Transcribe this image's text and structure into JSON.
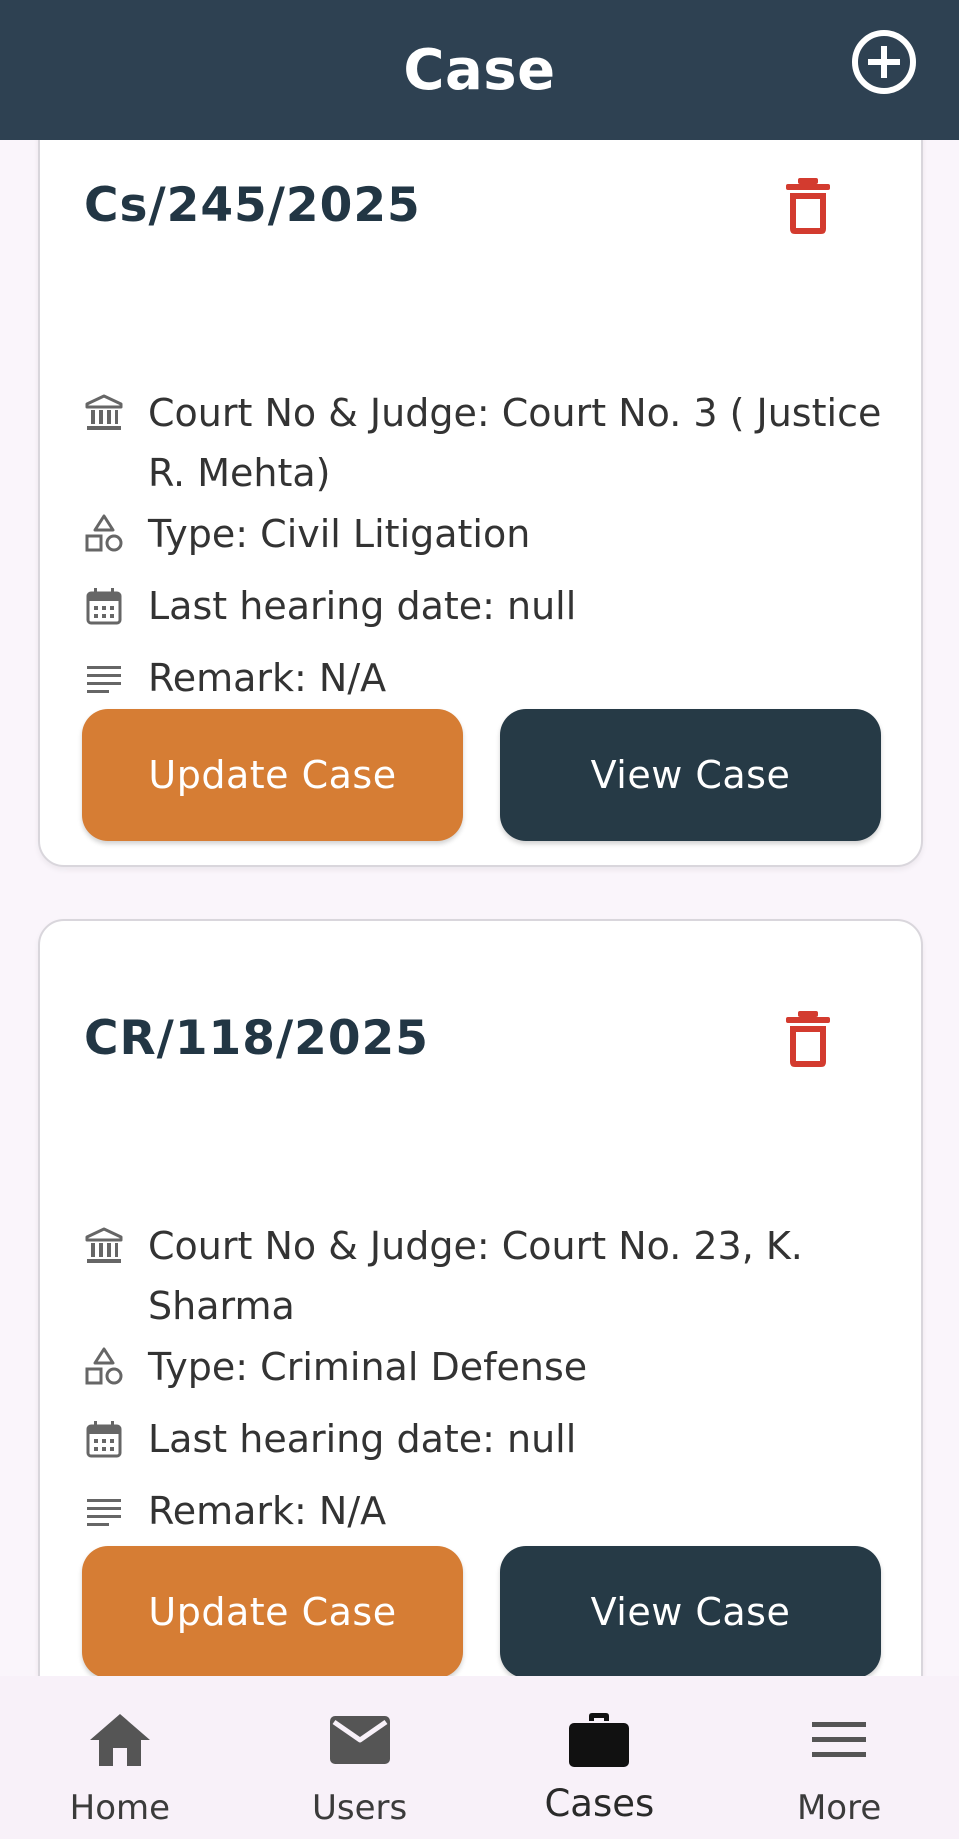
{
  "header": {
    "title": "Case",
    "add_icon": "add-circle-icon"
  },
  "cases": [
    {
      "case_no": "Cs/245/2025",
      "court_judge": "Court No & Judge: Court No. 3 ( Justice R. Mehta)",
      "type": "Type: Civil Litigation",
      "last_hearing": "Last hearing date: null",
      "remark": "Remark: N/A",
      "update_label": "Update Case",
      "view_label": "View Case"
    },
    {
      "case_no": "CR/118/2025",
      "court_judge": "Court No & Judge: Court No. 23, K. Sharma",
      "type": "Type: Criminal Defense",
      "last_hearing": "Last hearing date: null",
      "remark": "Remark: N/A",
      "update_label": "Update Case",
      "view_label": "View Case"
    }
  ],
  "icons": {
    "court": "bank-icon",
    "type": "category-icon",
    "date": "calendar-icon",
    "remark": "notes-icon",
    "delete": "trash-icon"
  },
  "colors": {
    "header_bg": "#2e4152",
    "update_button": "#d67d34",
    "view_button": "#263a46",
    "delete_icon": "#d33b2f",
    "case_no_text": "#223644"
  },
  "bottom_nav": {
    "items": [
      {
        "label": "Home",
        "icon": "home-icon"
      },
      {
        "label": "Users",
        "icon": "mail-icon"
      },
      {
        "label": "Cases",
        "icon": "briefcase-icon",
        "active": true
      },
      {
        "label": "More",
        "icon": "menu-icon"
      }
    ]
  }
}
